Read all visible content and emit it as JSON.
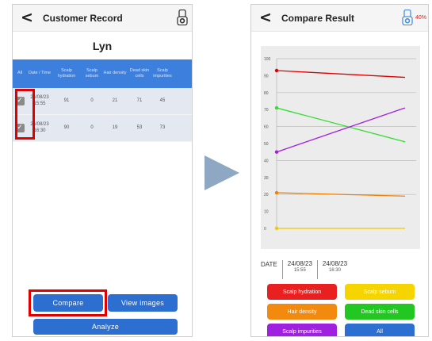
{
  "left_screen": {
    "back_glyph": "<",
    "title": "Customer Record",
    "customer_name": "Lyn",
    "table": {
      "headers": [
        "All",
        "Date / Time",
        "Scalp hydration",
        "Scalp sebum",
        "Hair density",
        "Dead skin cells",
        "Scalp impurities"
      ],
      "rows": [
        {
          "checked": true,
          "date": "24/08/23",
          "time": "15:55",
          "hydration": "91",
          "sebum": "0",
          "density": "21",
          "dead_skin": "71",
          "impurities": "45"
        },
        {
          "checked": true,
          "date": "24/08/23",
          "time": "16:30",
          "hydration": "90",
          "sebum": "0",
          "density": "19",
          "dead_skin": "53",
          "impurities": "73"
        }
      ]
    },
    "buttons": {
      "compare": "Compare",
      "view_images": "View images",
      "analyze": "Analyze"
    },
    "scanner_icon": "scanner-device-icon"
  },
  "right_screen": {
    "back_glyph": "<",
    "title": "Compare Result",
    "battery": "40%",
    "scanner_icon": "scanner-device-icon",
    "date_label": "DATE",
    "dates": [
      {
        "date": "24/08/23",
        "time": "15:55"
      },
      {
        "date": "24/08/23",
        "time": "16:30"
      }
    ],
    "legend_buttons": [
      {
        "label": "Scalp hydration",
        "color": "#e82020"
      },
      {
        "label": "Scalp sebum",
        "color": "#f5d400"
      },
      {
        "label": "Hair density",
        "color": "#f28a10"
      },
      {
        "label": "Dead skin cells",
        "color": "#22c722"
      },
      {
        "label": "Scalp impurities",
        "color": "#a020e0"
      },
      {
        "label": "All",
        "color": "#2c6fd1"
      }
    ]
  },
  "colors": {
    "header_blue": "#3d7fdd",
    "button_blue": "#2c6fd1",
    "highlight_red": "#e00000",
    "row_bg": "#e4e8f0",
    "arrow": "#8ea7c2"
  },
  "chart_data": {
    "type": "line",
    "x": [
      "24/08/23 15:55",
      "24/08/23 16:30"
    ],
    "ylim": [
      0,
      100
    ],
    "yticks": [
      0,
      10,
      20,
      30,
      40,
      50,
      60,
      70,
      80,
      90,
      100
    ],
    "grid": true,
    "series": [
      {
        "name": "Scalp hydration",
        "color": "#e00000",
        "values": [
          93,
          89
        ]
      },
      {
        "name": "Scalp sebum",
        "color": "#f0c800",
        "values": [
          0,
          0
        ]
      },
      {
        "name": "Hair density",
        "color": "#f08000",
        "values": [
          21,
          19
        ]
      },
      {
        "name": "Dead skin cells",
        "color": "#33dd33",
        "values": [
          71,
          51
        ]
      },
      {
        "name": "Scalp impurities",
        "color": "#a020e0",
        "values": [
          45,
          71
        ]
      }
    ]
  }
}
